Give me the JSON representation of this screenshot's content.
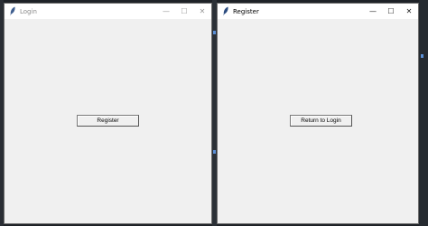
{
  "login_window": {
    "title": "Login",
    "register_button_label": "Register",
    "active": false
  },
  "register_window": {
    "title": "Register",
    "return_button_label": "Return to Login",
    "active": true
  },
  "window_controls": {
    "minimize": "—",
    "maximize": "☐",
    "close": "✕"
  },
  "icons": {
    "app_icon": "tk-feather-icon"
  }
}
